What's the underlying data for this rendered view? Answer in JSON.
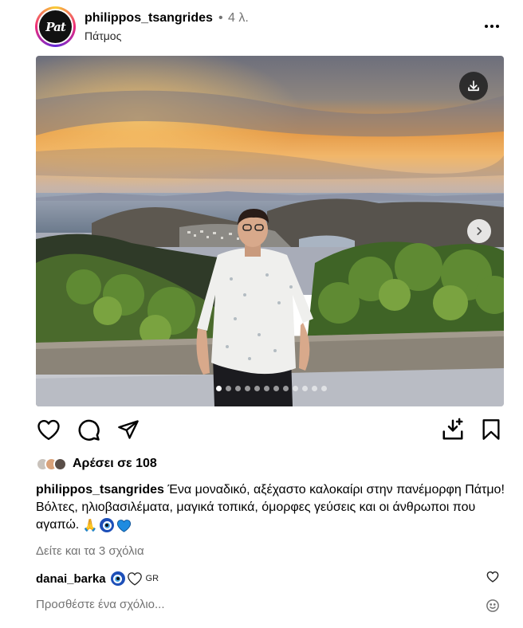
{
  "post": {
    "username": "philippos_tsangrides",
    "separator": "•",
    "time": "4 λ.",
    "location": "Πάτμος",
    "avatar_text": "Pat"
  },
  "media": {
    "slide_count": 12,
    "active_slide": 1,
    "download_icon": "download-icon",
    "next_icon": "chevron-right-icon"
  },
  "likes": {
    "text": "Αρέσει σε 108"
  },
  "caption": {
    "username": "philippos_tsangrides",
    "text": "Ένα μοναδικό, αξέχαστο καλοκαίρι στην πανέμορφη Πάτμο! Βόλτες, ηλιοβασιλέματα, μαγικά τοπικά, όμορφες γεύσεις και οι άνθρωποι που αγαπώ."
  },
  "comments": {
    "view_all": "Δείτε και τα 3 σχόλια",
    "first": {
      "username": "danai_barka",
      "suffix": "GR"
    },
    "add_placeholder": "Προσθέστε ένα σχόλιο..."
  },
  "colors": {
    "secondary_text": "#737373",
    "evil_eye_blue": "#1d4fb8",
    "heart_blue": "#1e8be0"
  }
}
